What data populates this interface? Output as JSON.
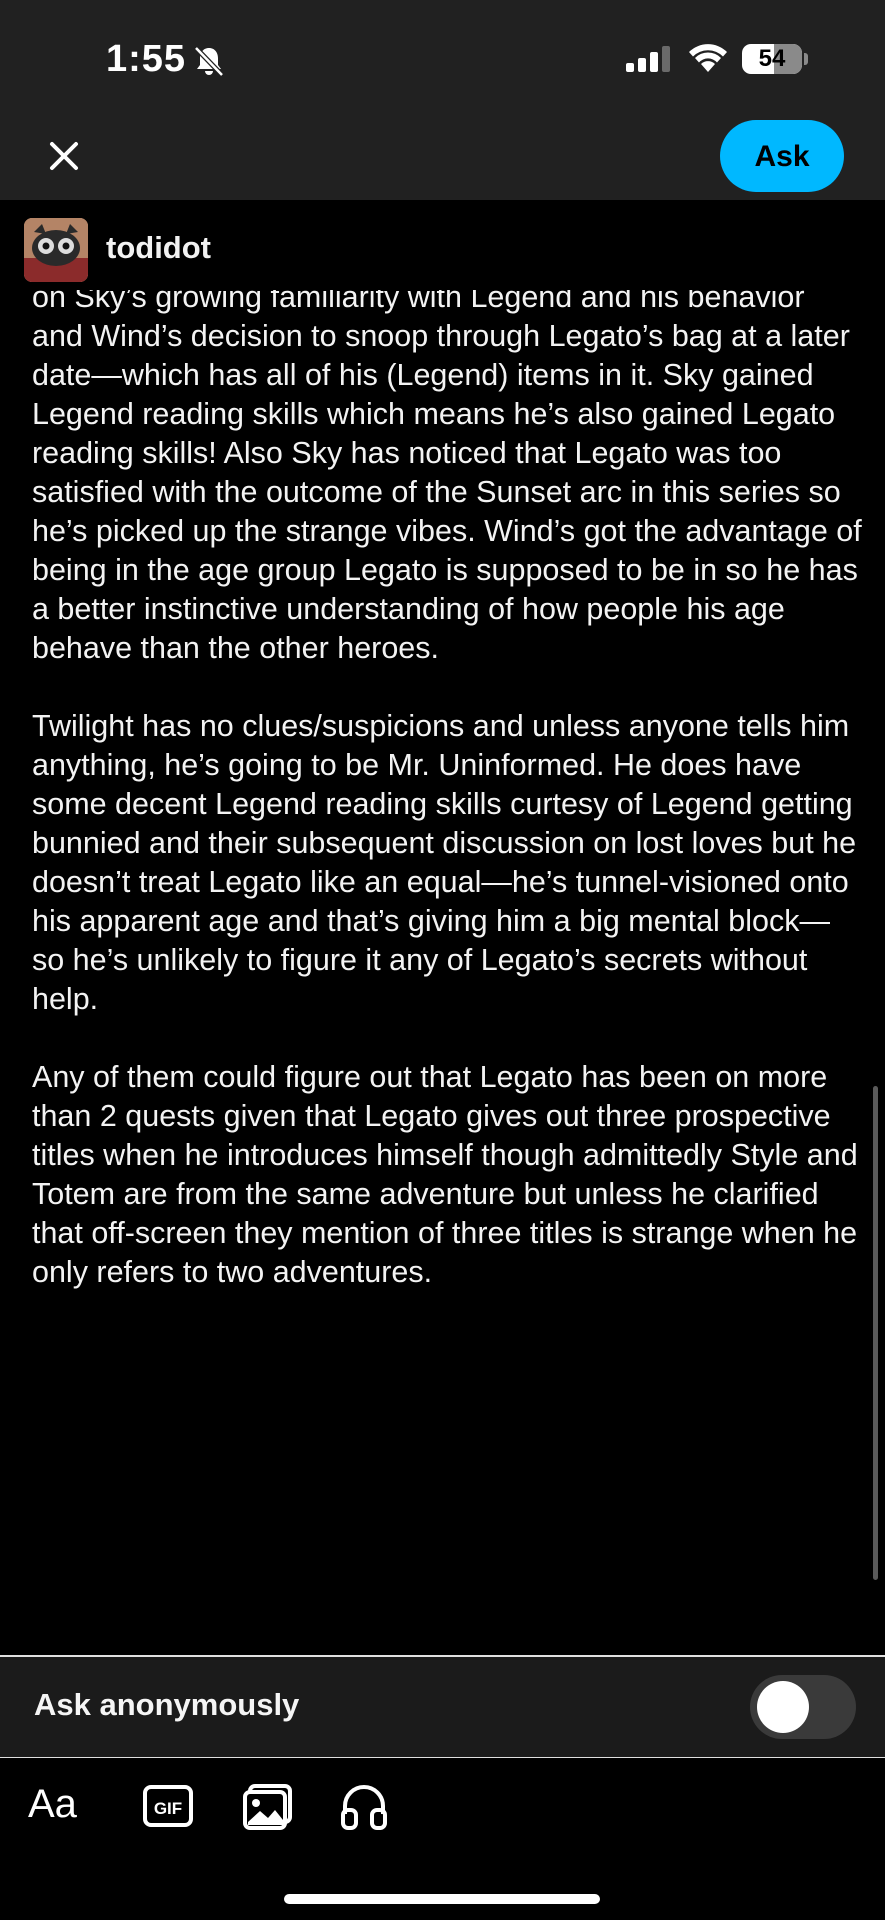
{
  "status_bar": {
    "time": "1:55",
    "battery": "54"
  },
  "header": {
    "ask_button_label": "Ask"
  },
  "user": {
    "username": "todidot"
  },
  "post": {
    "paragraphs": [
      "on Sky’s growing familiarity with Legend and his behavior and Wind’s decision to snoop through Legato’s bag at a later date—which has all of his (Legend) items in it. Sky gained Legend reading skills which means he’s also gained Legato reading skills! Also Sky has noticed that Legato was too satisfied with the outcome of the Sunset arc in this series so he’s picked up the strange vibes. Wind’s got the advantage of being in the age group Legato is supposed to be in so he has a better instinctive understanding of how people his age behave than the other heroes.",
      "Twilight has no clues/suspicions and unless anyone tells him anything, he’s going to be Mr. Uninformed. He does have some decent Legend reading skills curtesy of Legend getting bunnied and their subsequent discussion on lost loves but he doesn’t treat Legato like an equal—he’s tunnel-visioned onto his apparent age and that’s giving him a big mental block—so he’s unlikely to figure it any of Legato’s secrets without help.",
      "Any of them could figure out that Legato has been on more than 2 quests given that Legato gives out three prospective titles when he introduces himself though admittedly Style and Totem are from the same adventure but unless he clarified that off-screen they mention of three titles is strange when he only refers to two adventures."
    ]
  },
  "anonymous": {
    "label": "Ask anonymously",
    "enabled": false
  },
  "toolbar": {
    "text_format_label": "Aa",
    "gif_label": "GIF",
    "icons": [
      "text-format-icon",
      "gif-icon",
      "image-icon",
      "audio-icon"
    ]
  },
  "colors": {
    "accent": "#00b8ff",
    "background": "#000000",
    "header_bg": "#212121"
  }
}
